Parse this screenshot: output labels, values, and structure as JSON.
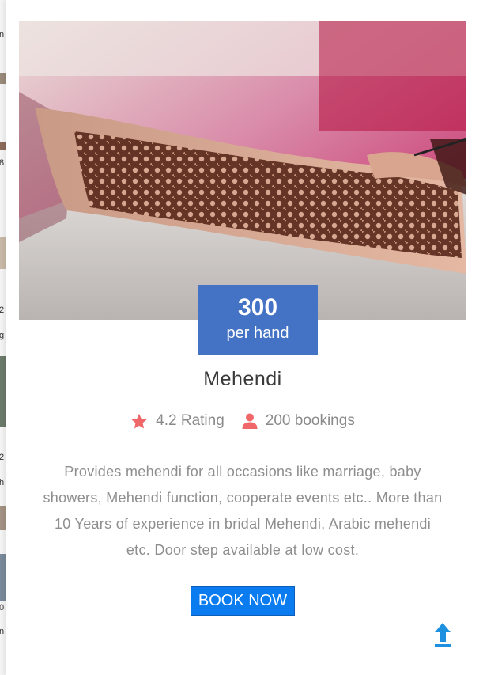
{
  "service": {
    "price": "300",
    "price_unit": "per hand",
    "title": "Mehendi",
    "rating_text": "4.2 Rating",
    "bookings_text": "200 bookings",
    "description": "Provides mehendi for all occasions like marriage, baby showers, Mehendi function, cooperate events etc.. More than 10 Years of experience in bridal Mehendi, Arabic mehendi etc. Door step available at low cost.",
    "book_label": "BOOK NOW"
  },
  "background_page": {
    "edge_glyphs": [
      "n",
      "8",
      "2",
      "g",
      "2",
      "h",
      "0",
      "n"
    ]
  },
  "icons": {
    "rating": "star-icon",
    "bookings": "user-icon",
    "scroll_top": "arrow-up-icon"
  },
  "colors": {
    "price_box": "#4472c4",
    "icon_accent": "#f0676a",
    "book_button": "#0a7cf0",
    "scroll_top": "#1e90e0",
    "muted_text": "#8e8e8e"
  }
}
